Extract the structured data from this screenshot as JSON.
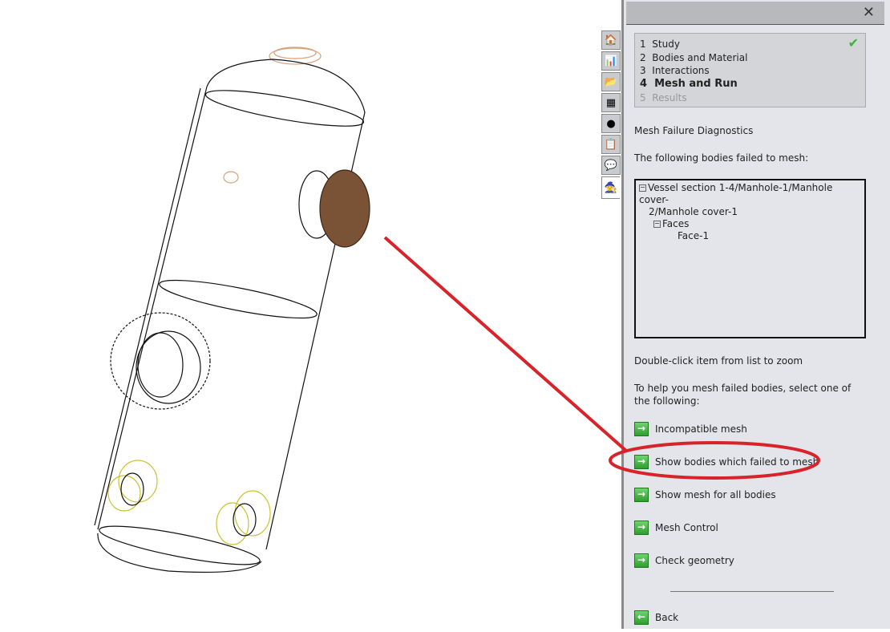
{
  "panel": {
    "close_icon": "close-icon",
    "steps": [
      {
        "num": "1",
        "label": "Study",
        "state": "done"
      },
      {
        "num": "2",
        "label": "Bodies and Material"
      },
      {
        "num": "3",
        "label": "Interactions"
      },
      {
        "num": "4",
        "label": "Mesh and Run",
        "state": "current"
      },
      {
        "num": "5",
        "label": "Results",
        "state": "disabled"
      }
    ],
    "title": "Mesh Failure Diagnostics",
    "failed_label": "The following bodies failed to mesh:",
    "tree": {
      "root_line1": "Vessel section 1-4/Manhole-1/Manhole cover-",
      "root_line2": "2/Manhole cover-1",
      "faces": "Faces",
      "face": "Face-1"
    },
    "zoom_hint": "Double-click item from list to zoom",
    "help_text": "To help you mesh failed bodies, select one of the following:",
    "actions": [
      "Incompatible mesh",
      "Show bodies which failed to mesh",
      "Show mesh for all bodies",
      "Mesh Control",
      "Check geometry"
    ],
    "back": "Back"
  },
  "tabs": [
    "home-icon",
    "chart-icon",
    "folder-icon",
    "layout-icon",
    "color-icon",
    "notes-icon",
    "chat-icon",
    "wizard-icon"
  ],
  "colors": {
    "annotation": "#d8232a",
    "accent_green": "#3ab53a",
    "cover": "#7a5235"
  }
}
